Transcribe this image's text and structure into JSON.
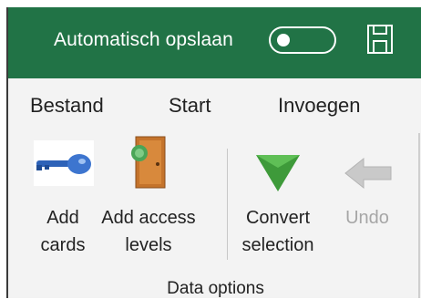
{
  "titlebar": {
    "autosave_label": "Automatisch opslaan",
    "toggle_state": "off",
    "accent_color": "#217346"
  },
  "menu": {
    "items": [
      {
        "label": "Bestand"
      },
      {
        "label": "Start"
      },
      {
        "label": "Invoegen"
      }
    ]
  },
  "ribbon": {
    "buttons": [
      {
        "line1": "Add",
        "line2": "cards",
        "icon": "key-icon",
        "enabled": true
      },
      {
        "line1": "Add access",
        "line2": "levels",
        "icon": "door-icon",
        "enabled": true
      },
      {
        "line1": "Convert",
        "line2": "selection",
        "icon": "green-triangle-down-icon",
        "enabled": true
      },
      {
        "line1": "Undo",
        "line2": "",
        "icon": "undo-arrow-icon",
        "enabled": false
      }
    ],
    "group_label": "Data options"
  }
}
